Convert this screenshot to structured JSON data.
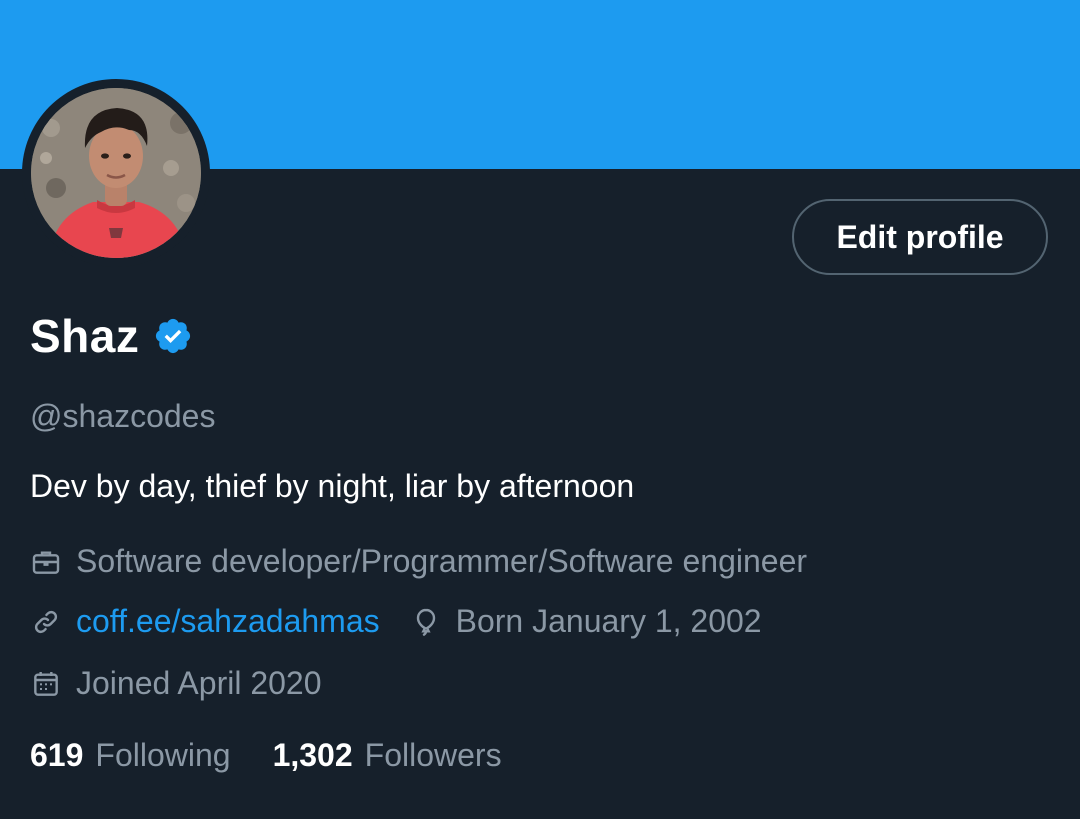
{
  "profile": {
    "name": "Shaz",
    "handle": "@shazcodes",
    "bio": "Dev by day, thief by night, liar by afternoon",
    "verified_icon": "verified-badge-icon",
    "edit_profile_label": "Edit profile"
  },
  "meta": {
    "profession": "Software developer/Programmer/Software engineer",
    "website": "coff.ee/sahzadahmas",
    "birthday": "Born January 1, 2002",
    "joined": "Joined April 2020"
  },
  "stats": {
    "following_count": "619",
    "following_label": "Following",
    "followers_count": "1,302",
    "followers_label": "Followers"
  },
  "icons": {
    "profession": "briefcase-icon",
    "website": "link-icon",
    "birthday": "balloon-icon",
    "joined": "calendar-icon"
  },
  "colors": {
    "banner": "#1d9bf0",
    "background": "#16202b",
    "accent": "#1d9bf0",
    "secondary_text": "#8b98a5",
    "button_border": "#536471"
  }
}
